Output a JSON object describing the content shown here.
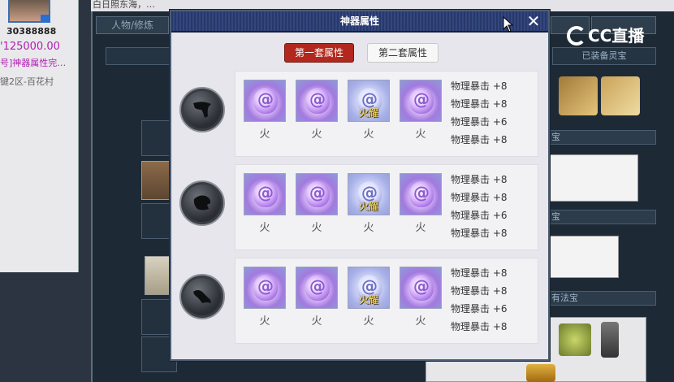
{
  "background": {
    "user_id": "30388888",
    "gold": "'125000.00",
    "title_line": "号]神器属性完…",
    "location": "键2区-百花村",
    "tab_character": "人物/修炼",
    "equipped_treasure_label": "已装备灵宝",
    "section_1": "宝",
    "section_2": "宝",
    "section_3": "有法宝",
    "top_text": "白日照东海，…"
  },
  "dialog": {
    "title": "神器属性",
    "close_label": "✕",
    "tabs": [
      {
        "label": "第一套属性",
        "active": true
      },
      {
        "label": "第二套属性",
        "active": false
      }
    ],
    "sets": [
      {
        "icon": "artifact-set-1-icon",
        "gems": [
          {
            "label": "火",
            "tag": ""
          },
          {
            "label": "火",
            "tag": ""
          },
          {
            "label": "火",
            "tag": "火耀"
          },
          {
            "label": "火",
            "tag": ""
          }
        ],
        "stats": [
          "物理暴击 +8",
          "物理暴击 +8",
          "物理暴击 +6",
          "物理暴击 +8"
        ]
      },
      {
        "icon": "artifact-set-2-icon",
        "gems": [
          {
            "label": "火",
            "tag": ""
          },
          {
            "label": "火",
            "tag": ""
          },
          {
            "label": "火",
            "tag": "火耀"
          },
          {
            "label": "火",
            "tag": ""
          }
        ],
        "stats": [
          "物理暴击 +8",
          "物理暴击 +8",
          "物理暴击 +6",
          "物理暴击 +8"
        ]
      },
      {
        "icon": "artifact-set-3-icon",
        "gems": [
          {
            "label": "火",
            "tag": ""
          },
          {
            "label": "火",
            "tag": ""
          },
          {
            "label": "火",
            "tag": "火耀"
          },
          {
            "label": "火",
            "tag": ""
          }
        ],
        "stats": [
          "物理暴击 +8",
          "物理暴击 +8",
          "物理暴击 +6",
          "物理暴击 +8"
        ]
      }
    ]
  },
  "watermark": {
    "text": "CC直播"
  },
  "colors": {
    "active_tab": "#b3281e",
    "title_bar": "#2d3f74",
    "gem_tag": "#f7e45a"
  }
}
